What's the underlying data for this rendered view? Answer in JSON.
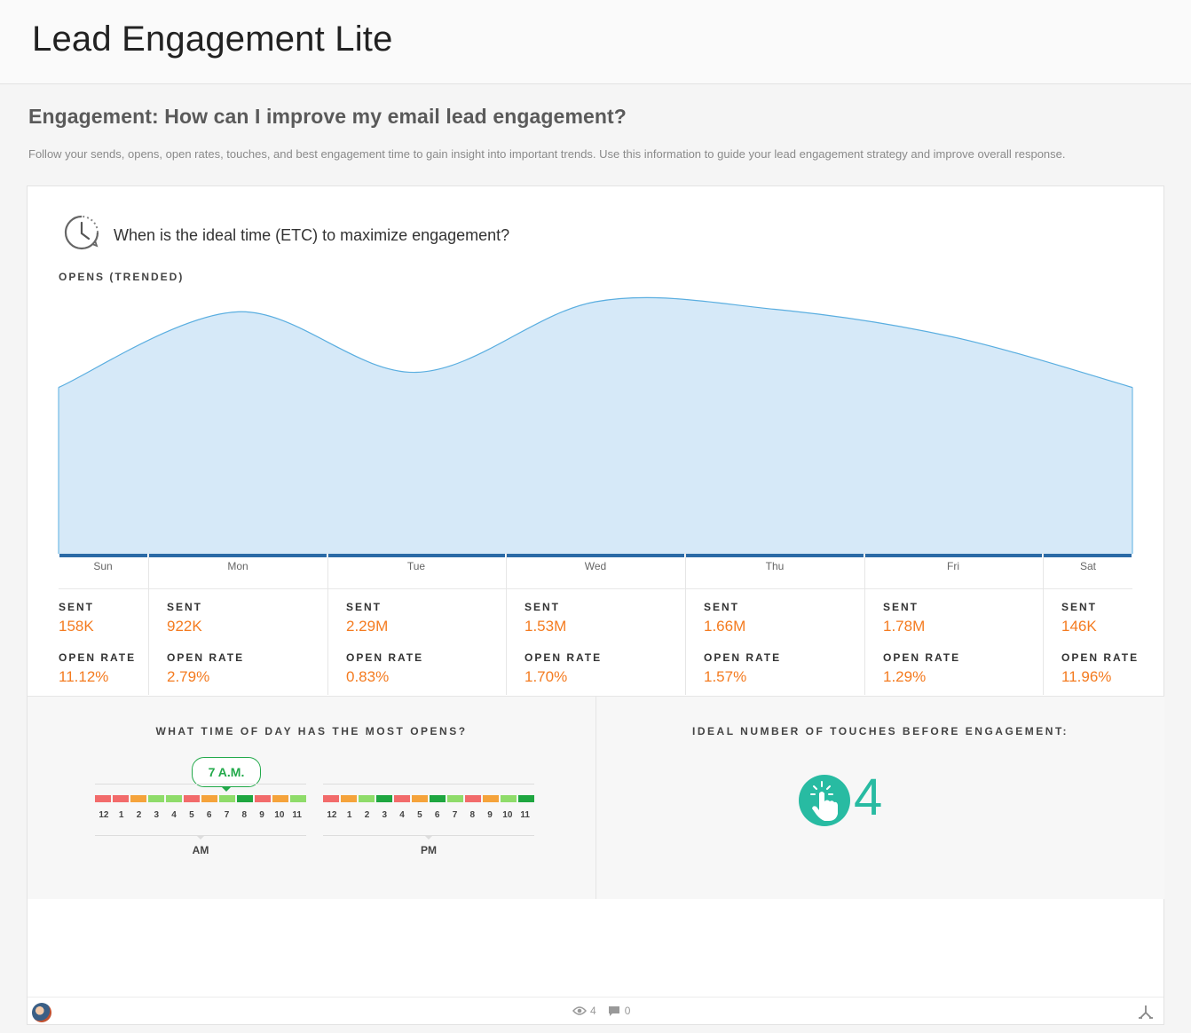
{
  "app": {
    "title": "Lead Engagement Lite"
  },
  "section": {
    "heading": "Engagement: How can I improve my email lead engagement?",
    "description": "Follow your sends, opens, open rates, touches, and best engagement time to gain insight into important trends. Use this information to guide your lead engagement strategy and improve overall response."
  },
  "card": {
    "question": "When is the ideal time (ETC) to maximize engagement?",
    "opens_label": "OPENS (TRENDED)",
    "stat_labels": {
      "sent": "SENT",
      "open_rate": "OPEN RATE"
    }
  },
  "chart_data": {
    "type": "area",
    "title": "OPENS (TRENDED)",
    "categories": [
      "Sun",
      "Mon",
      "Tue",
      "Wed",
      "Thu",
      "Fri",
      "Sat"
    ],
    "series": [
      {
        "values": [
          0.66,
          0.96,
          0.72,
          1.0,
          0.97,
          0.86,
          0.66
        ]
      }
    ],
    "sent": [
      "158K",
      "922K",
      "2.29M",
      "1.53M",
      "1.66M",
      "1.78M",
      "146K"
    ],
    "open_rate": [
      "11.12%",
      "2.79%",
      "0.83%",
      "1.70%",
      "1.57%",
      "1.29%",
      "11.96%"
    ],
    "colors": {
      "fill": "#d6e9f8",
      "line": "#5aaee0",
      "axis": "#2b6aa6"
    }
  },
  "time_of_day": {
    "title": "WHAT TIME OF DAY HAS THE MOST OPENS?",
    "callout": "7 A.M.",
    "hours": [
      "12",
      "1",
      "2",
      "3",
      "4",
      "5",
      "6",
      "7",
      "8",
      "9",
      "10",
      "11"
    ],
    "am_label": "AM",
    "pm_label": "PM",
    "am_colors": [
      "#f26b6b",
      "#f26b6b",
      "#f5a33b",
      "#8fdc6a",
      "#8fdc6a",
      "#f26b6b",
      "#f5a33b",
      "#8fdc6a",
      "#1ea640",
      "#f26b6b",
      "#f5a33b",
      "#8fdc6a"
    ],
    "pm_colors": [
      "#f26b6b",
      "#f5a33b",
      "#8fdc6a",
      "#1ea640",
      "#f26b6b",
      "#f5a33b",
      "#1ea640",
      "#8fdc6a",
      "#f26b6b",
      "#f5a33b",
      "#8fdc6a",
      "#1ea640"
    ]
  },
  "touches": {
    "title": "IDEAL NUMBER OF TOUCHES BEFORE ENGAGEMENT:",
    "value": "4",
    "icon": "hand-pointer-icon"
  },
  "footer": {
    "views": "4",
    "comments": "0"
  }
}
